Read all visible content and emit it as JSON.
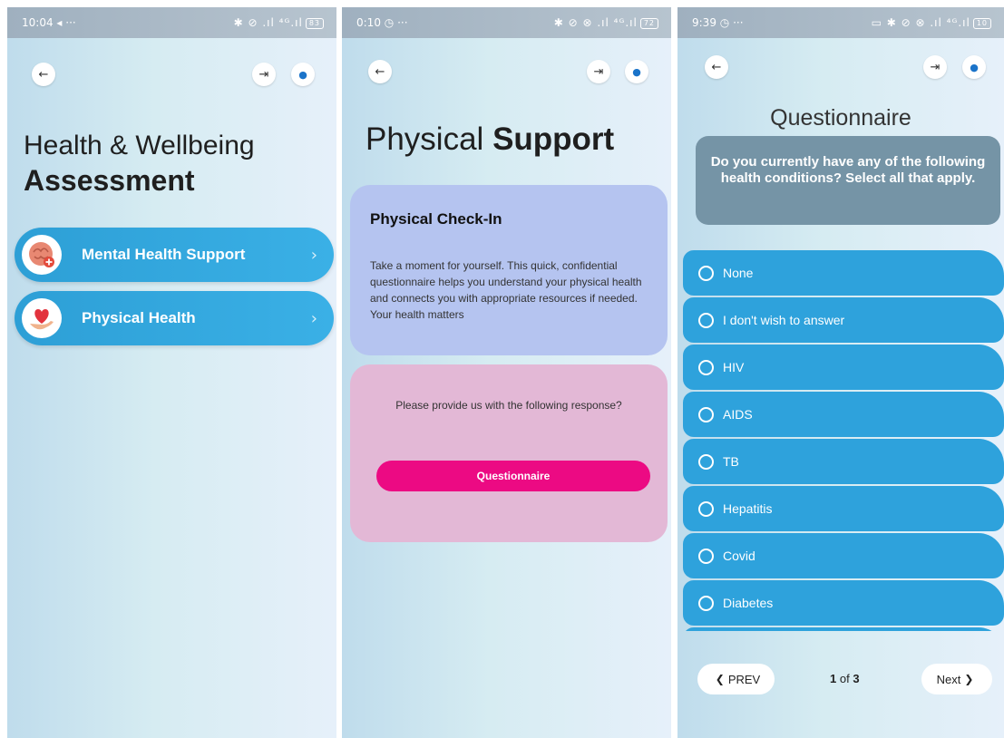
{
  "screens": [
    {
      "status": {
        "time": "10:04",
        "time_extra": "◂ ···",
        "icons": "✱ ⊘ .ıl ⁴ᴳ.ıl",
        "battery": "83"
      },
      "title_light": "Health & Wellbeing",
      "title_bold": "Assessment",
      "menu": [
        {
          "label": "Mental Health Support",
          "chevron": "›"
        },
        {
          "label": "Physical Health",
          "chevron": "›"
        }
      ]
    },
    {
      "status": {
        "time": "0:10",
        "time_extra": "◷ ···",
        "icons": "✱ ⊘ ⊗ .ıl ⁴ᴳ.ıl",
        "battery": "72"
      },
      "title_light": "Physical",
      "title_bold": "Support",
      "checkin": {
        "heading": "Physical Check-In",
        "body": "Take a moment for yourself. This quick, confidential questionnaire helps you understand your physical health and connects you with appropriate resources if needed. Your health matters"
      },
      "prompt": {
        "text": "Please provide us with the following response?",
        "button_label": "Questionnaire"
      }
    },
    {
      "status": {
        "time": "9:39",
        "time_extra": "◷ ···",
        "icons": "▭ ✱ ⊘ ⊗ .ıl ⁴ᴳ.ıl",
        "battery": "10"
      },
      "title": "Questionnaire",
      "question": "Do you currently have any of the following health conditions? Select all that apply.",
      "options": [
        "None",
        "I don't wish to answer",
        "HIV",
        "AIDS",
        "TB",
        "Hepatitis",
        "Covid",
        "Diabetes"
      ],
      "nav": {
        "prev_label": "PREV",
        "next_label": "Next",
        "current_page": "1",
        "of_label": "of",
        "total_pages": "3"
      }
    }
  ],
  "colors": {
    "accent_blue": "#2ea2dc",
    "pink_button": "#ec0a83",
    "card_blue": "#b5c4f0",
    "card_pink": "#e3b8d6",
    "question_box": "#7594a6"
  },
  "icons": {
    "back": "arrow-left-icon",
    "logout": "logout-icon",
    "profile": "user-icon",
    "mental_health": "brain-plus-icon",
    "physical_health": "heart-hand-icon",
    "chevron": "chevron-right-icon",
    "prev": "chevron-left-icon",
    "next": "chevron-right-icon"
  }
}
